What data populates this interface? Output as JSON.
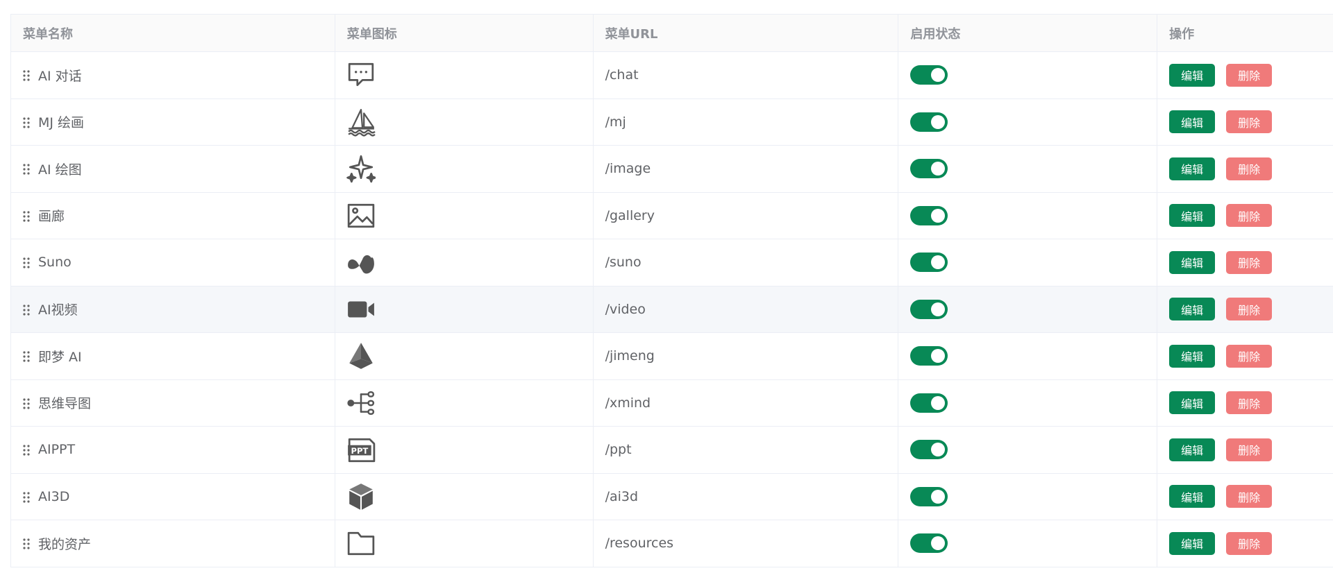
{
  "headers": [
    "菜单名称",
    "菜单图标",
    "菜单URL",
    "启用状态",
    "操作"
  ],
  "actions": {
    "edit": "编辑",
    "delete": "删除"
  },
  "colors": {
    "primary": "#088956",
    "danger": "#f07a7a",
    "border": "#ebeef5",
    "hover": "#f5f7fa"
  },
  "rows": [
    {
      "name": "AI 对话",
      "icon": "chat-bubble-icon",
      "url": "/chat",
      "enabled": true
    },
    {
      "name": "MJ 绘画",
      "icon": "sailboat-icon",
      "url": "/mj",
      "enabled": true
    },
    {
      "name": "AI 绘图",
      "icon": "sparkle-icon",
      "url": "/image",
      "enabled": true
    },
    {
      "name": "画廊",
      "icon": "image-icon",
      "url": "/gallery",
      "enabled": true
    },
    {
      "name": "Suno",
      "icon": "wave-icon",
      "url": "/suno",
      "enabled": true
    },
    {
      "name": "AI视频",
      "icon": "video-camera-icon",
      "url": "/video",
      "enabled": true
    },
    {
      "name": "即梦 AI",
      "icon": "prism-icon",
      "url": "/jimeng",
      "enabled": true
    },
    {
      "name": "思维导图",
      "icon": "mindmap-icon",
      "url": "/xmind",
      "enabled": true
    },
    {
      "name": "AIPPT",
      "icon": "ppt-file-icon",
      "url": "/ppt",
      "enabled": true
    },
    {
      "name": "AI3D",
      "icon": "cube-icon",
      "url": "/ai3d",
      "enabled": true
    },
    {
      "name": "我的资产",
      "icon": "folder-icon",
      "url": "/resources",
      "enabled": true
    }
  ],
  "hover_row": 5
}
